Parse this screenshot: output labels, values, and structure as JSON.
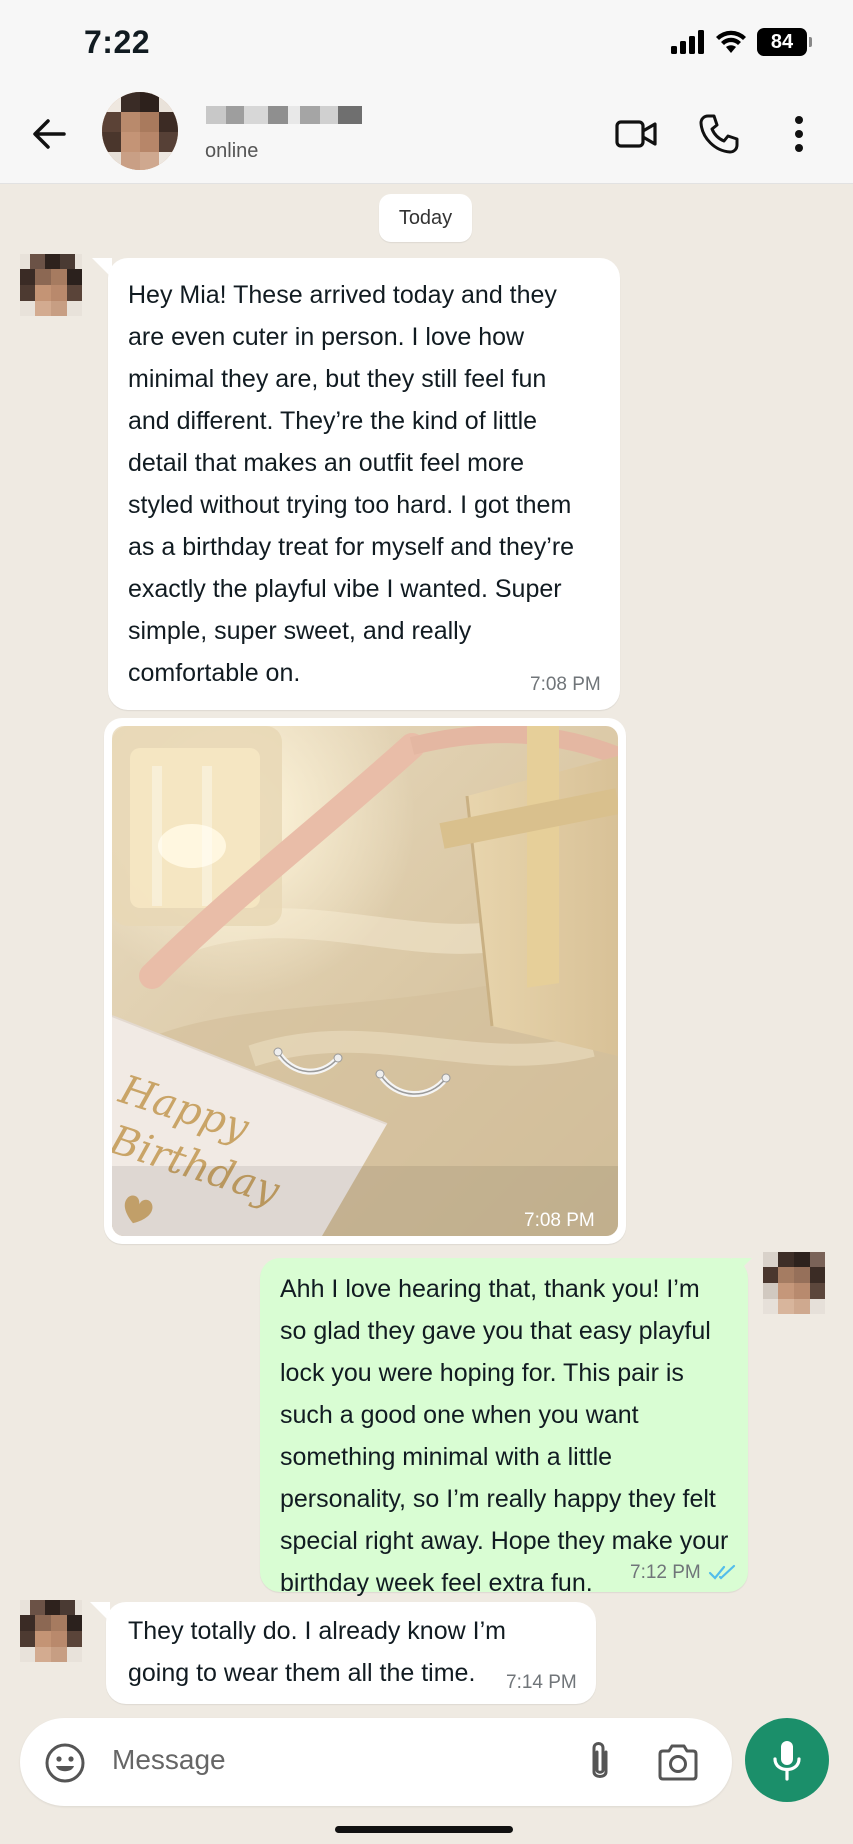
{
  "status_bar": {
    "time": "7:22",
    "battery": "84"
  },
  "header": {
    "contact_status": "online"
  },
  "chat": {
    "date_chip": "Today",
    "messages": [
      {
        "direction": "incoming",
        "text": "Hey Mia! These arrived today and they\nare even cuter in person. I love how\nminimal they are, but they still feel fun\nand different. They’re the kind of little\ndetail that makes an outfit feel more\nstyled without trying too hard. I got them\nas a birthday treat for myself and they’re\nexactly the playful vibe I wanted. Super\nsimple, super sweet, and really\ncomfortable on.",
        "time": "7:08 PM"
      },
      {
        "direction": "incoming",
        "type": "image",
        "card_text": [
          "Happy",
          "Birthday"
        ],
        "time": "7:08 PM"
      },
      {
        "direction": "outgoing",
        "text": "Ahh I love hearing that, thank you! I’m\nso glad they gave you that easy playful\nlock you were hoping for. This pair is\nsuch a good one when you want\nsomething minimal with a little\npersonality, so I’m really happy they felt\nspecial right away. Hope they make your\nbirthday week feel extra fun.",
        "time": "7:12 PM",
        "read": true
      },
      {
        "direction": "incoming",
        "text": "They totally do. I already know I’m\ngoing to wear them all the time.",
        "time": "7:14 PM"
      }
    ]
  },
  "input": {
    "placeholder": "Message"
  },
  "colors": {
    "chat_bg": "#efeae2",
    "outgoing_bubble": "#d9fdd3",
    "accent_green": "#1b8f6a",
    "read_ticks": "#53bdeb"
  },
  "icons": [
    "back-arrow-icon",
    "video-call-icon",
    "phone-icon",
    "more-options-icon",
    "emoji-icon",
    "attach-icon",
    "camera-icon",
    "mic-icon",
    "double-check-icon"
  ]
}
